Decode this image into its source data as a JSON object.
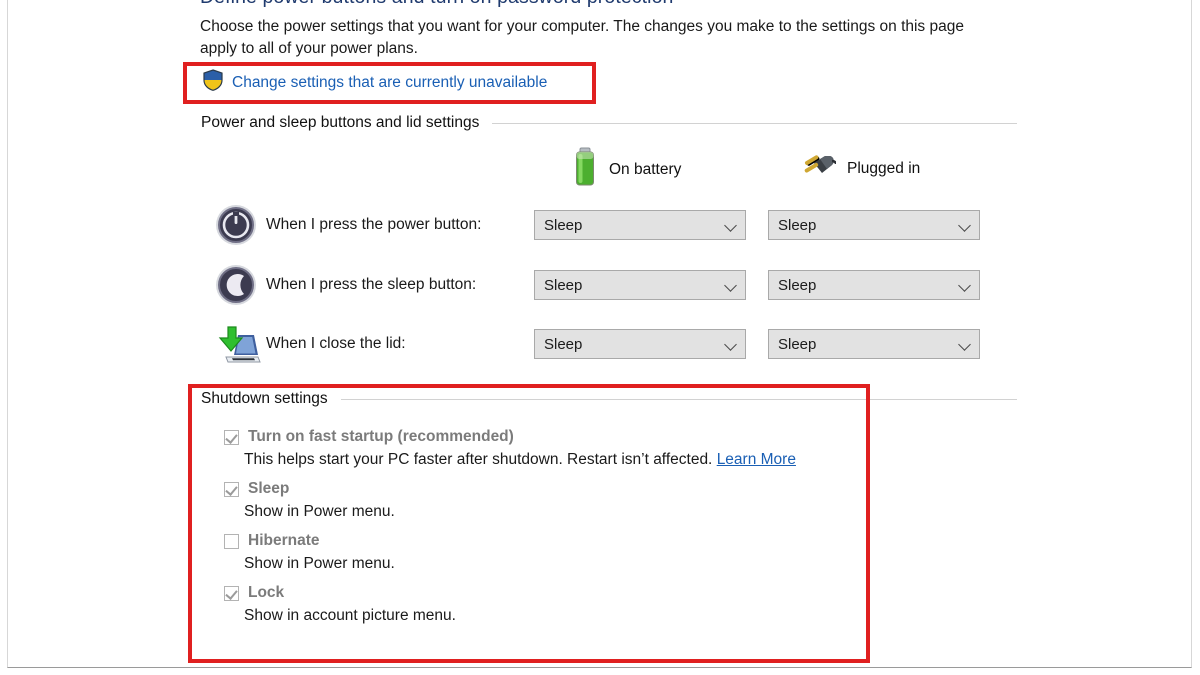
{
  "page": {
    "title": "Define power buttons and turn on password protection",
    "intro": "Choose the power settings that you want for your computer. The changes you make to the settings on this page apply to all of your power plans."
  },
  "uac": {
    "link_label": "Change settings that are currently unavailable",
    "icon": "shield-icon",
    "link_color": "#1a5fb4"
  },
  "groups": {
    "power_and_sleep": "Power and sleep buttons and lid settings",
    "shutdown": "Shutdown settings"
  },
  "columns": {
    "battery": {
      "label": "On battery",
      "icon": "battery-icon"
    },
    "plugged": {
      "label": "Plugged in",
      "icon": "power-plug-icon"
    }
  },
  "rows": [
    {
      "icon": "power-button-icon",
      "label": "When I press the power button:",
      "battery_value": "Sleep",
      "plugged_value": "Sleep"
    },
    {
      "icon": "sleep-moon-icon",
      "label": "When I press the sleep button:",
      "battery_value": "Sleep",
      "plugged_value": "Sleep"
    },
    {
      "icon": "laptop-lid-icon",
      "label": "When I close the lid:",
      "battery_value": "Sleep",
      "plugged_value": "Sleep"
    }
  ],
  "shutdown_options": [
    {
      "label": "Turn on fast startup (recommended)",
      "checked": true,
      "description_before_link": "This helps start your PC faster after shutdown. Restart isn’t affected. ",
      "link_label": "Learn More"
    },
    {
      "label": "Sleep",
      "checked": true,
      "description": "Show in Power menu."
    },
    {
      "label": "Hibernate",
      "checked": false,
      "description": "Show in Power menu."
    },
    {
      "label": "Lock",
      "checked": true,
      "description": "Show in account picture menu."
    }
  ],
  "annotations": {
    "highlight_color": "#e02020",
    "boxes": [
      "uac-link-highlight",
      "shutdown-settings-highlight"
    ]
  }
}
